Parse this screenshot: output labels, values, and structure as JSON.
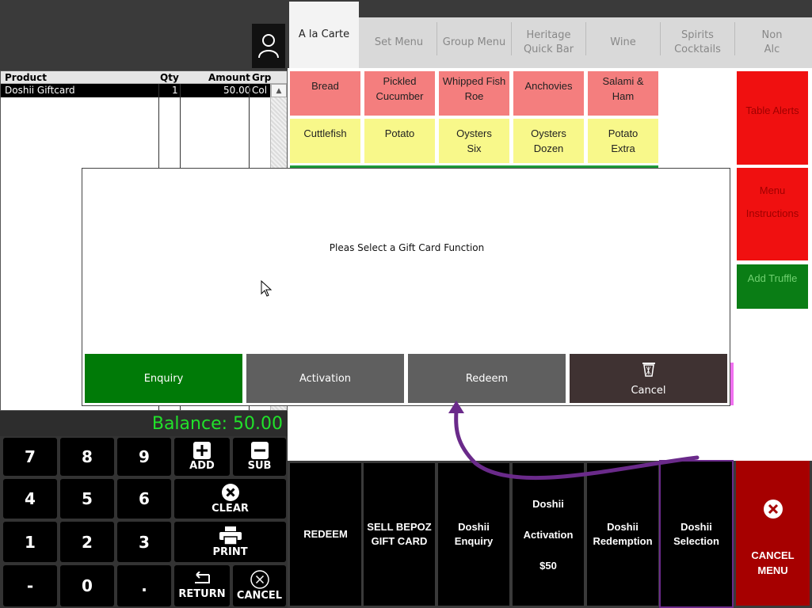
{
  "tabs": [
    {
      "label": "A la Carte",
      "active": true
    },
    {
      "label": "Set Menu"
    },
    {
      "label": "Group Menu"
    },
    {
      "label": "Heritage\nQuick Bar"
    },
    {
      "label": "Wine"
    },
    {
      "label": "Spirits\nCocktails"
    },
    {
      "label": "Non\nAlc"
    }
  ],
  "order_grid": {
    "headers": [
      "Product",
      "Qty",
      "Amount",
      "Grp"
    ],
    "rows": [
      {
        "product": "Doshii Giftcard",
        "qty": "1",
        "amount": "50.00",
        "grp": "Col"
      }
    ]
  },
  "products": [
    {
      "label": "Bread",
      "color": "#f47e7e"
    },
    {
      "label": "Pickled\nCucumber",
      "color": "#f47e7e"
    },
    {
      "label": "Whipped Fish\nRoe",
      "color": "#f47e7e"
    },
    {
      "label": "Anchovies",
      "color": "#f47e7e"
    },
    {
      "label": "Salami &\nHam",
      "color": "#f47e7e"
    },
    {
      "label": "Cuttlefish",
      "color": "#f8f88a"
    },
    {
      "label": "Potato",
      "color": "#f8f88a"
    },
    {
      "label": "Oysters\nSix",
      "color": "#f8f88a"
    },
    {
      "label": "Oysters\nDozen",
      "color": "#f8f88a"
    },
    {
      "label": "Potato\nExtra",
      "color": "#f8f88a"
    }
  ],
  "side_buttons": {
    "table_alerts": "Table Alerts",
    "menu_instructions_1": "Menu",
    "menu_instructions_2": "Instructions",
    "add_truffle": "Add Truffle"
  },
  "dialog": {
    "message": "Pleas Select a Gift Card Function",
    "buttons": {
      "enquiry": "Enquiry",
      "activation": "Activation",
      "redeem": "Redeem",
      "cancel": "Cancel"
    },
    "colors": {
      "enquiry": "#007a07",
      "activation": "#5f5f5f",
      "redeem": "#5f5f5f",
      "cancel": "#3f3232"
    }
  },
  "balance": "Balance: 50.00",
  "keypad": {
    "k7": "7",
    "k8": "8",
    "k9": "9",
    "k4": "4",
    "k5": "5",
    "k6": "6",
    "k1": "1",
    "k2": "2",
    "k3": "3",
    "kminus": "-",
    "k0": "0",
    "kdot": ".",
    "add": "ADD",
    "sub": "SUB",
    "clear": "CLEAR",
    "print": "PRINT",
    "return": "RETURN",
    "cancel": "CANCEL"
  },
  "function_buttons": {
    "redeem": "REDEEM",
    "sell_bepoz": "SELL BEPOZ\nGIFT CARD",
    "doshii_enquiry": "Doshii\nEnquiry",
    "doshii_activation_1": "Doshii",
    "doshii_activation_2": "Activation",
    "doshii_activation_3": "$50",
    "doshii_redemption": "Doshii\nRedemption",
    "doshii_selection": "Doshii\nSelection",
    "cancel_menu_1": "CANCEL",
    "cancel_menu_2": "MENU"
  }
}
